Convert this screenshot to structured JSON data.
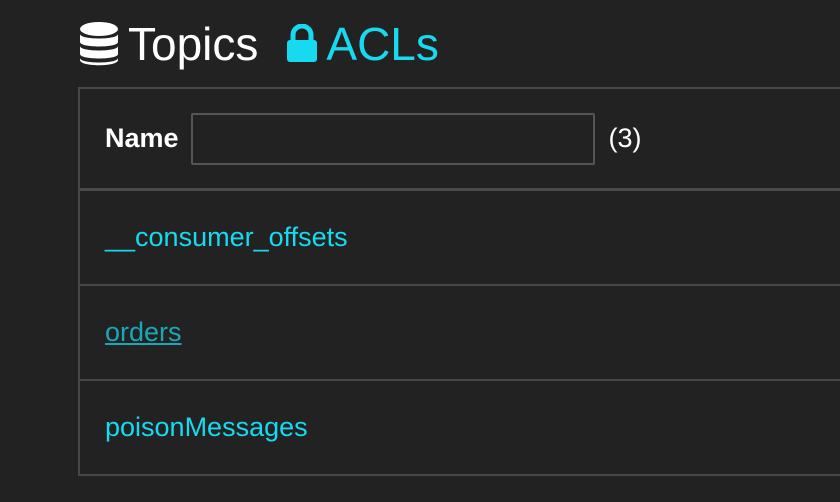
{
  "nav": {
    "topics_label": "Topics",
    "acls_label": "ACLs",
    "topics_icon": "database-icon",
    "acls_icon": "lock-icon"
  },
  "table": {
    "filter_label": "Name",
    "filter_value": "",
    "filter_placeholder": "",
    "count": "(3)",
    "topics": [
      "__consumer_offsets",
      "orders",
      "poisonMessages"
    ]
  },
  "colors": {
    "background": "#222222",
    "accent": "#17d9f0",
    "accent_hover": "#1aa8b8",
    "border": "#474747"
  }
}
